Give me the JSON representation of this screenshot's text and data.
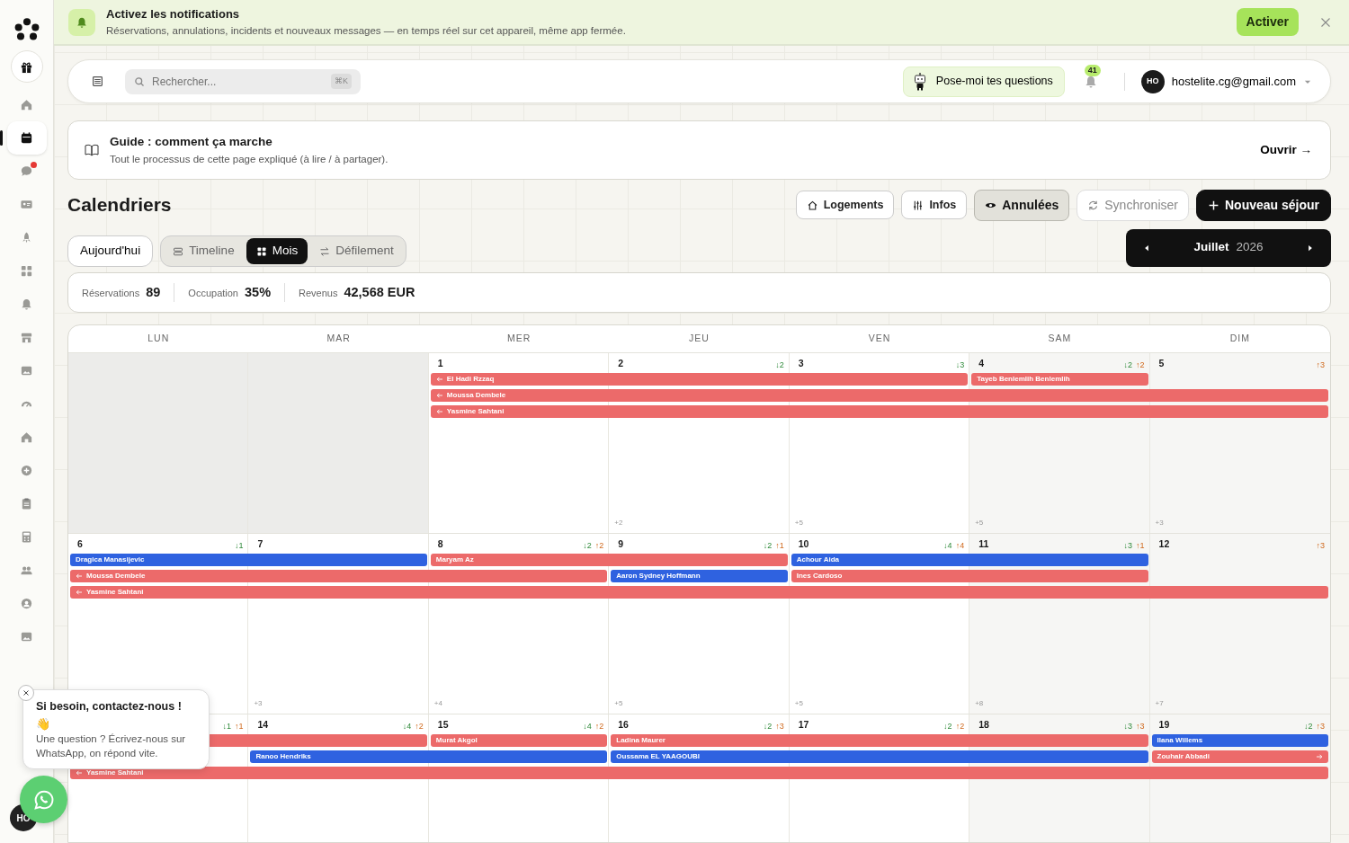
{
  "banner": {
    "title": "Activez les notifications",
    "text": "Réservations, annulations, incidents et nouveaux messages — en temps réel sur cet appareil, même app fermée.",
    "action": "Activer"
  },
  "sidebar": {
    "items": [
      {
        "selected": false,
        "badge": false
      },
      {
        "selected": false,
        "badge": false
      },
      {
        "selected": true,
        "badge": false
      },
      {
        "selected": false,
        "badge": true
      },
      {
        "selected": false,
        "badge": false
      },
      {
        "selected": false,
        "badge": false
      },
      {
        "selected": false,
        "badge": false
      },
      {
        "selected": false,
        "badge": false
      },
      {
        "selected": false,
        "badge": false
      },
      {
        "selected": false,
        "badge": false
      },
      {
        "selected": false,
        "badge": false
      },
      {
        "selected": false,
        "badge": false
      },
      {
        "selected": false,
        "badge": false
      },
      {
        "selected": false,
        "badge": false
      },
      {
        "selected": false,
        "badge": false
      },
      {
        "selected": false,
        "badge": false
      },
      {
        "selected": false,
        "badge": false
      },
      {
        "selected": false,
        "badge": false
      }
    ],
    "avatar": "HO"
  },
  "header": {
    "search": {
      "placeholder": "Rechercher...",
      "shortcut": "⌘K"
    },
    "assistant": "Pose-moi tes questions",
    "notifications": "41",
    "user": {
      "initials": "HO",
      "email": "hostelite.cg@gmail.com"
    }
  },
  "guide": {
    "title": "Guide : comment ça marche",
    "text": "Tout le processus de cette page expliqué (à lire / à partager).",
    "action": "Ouvrir →"
  },
  "title": "Calendriers",
  "actions": [
    {
      "label": "Logements",
      "kind": "outline",
      "on": false
    },
    {
      "label": "Infos",
      "kind": "outline",
      "on": false
    },
    {
      "label": "Annulées",
      "kind": "toggle",
      "on": true
    },
    {
      "label": "Synchroniser",
      "kind": "muted",
      "on": false
    },
    {
      "label": "Nouveau séjour",
      "kind": "primary",
      "on": false
    }
  ],
  "today": "Aujourd'hui",
  "views": [
    {
      "label": "Timeline",
      "selected": false
    },
    {
      "label": "Mois",
      "selected": true
    },
    {
      "label": "Défilement",
      "selected": false
    }
  ],
  "month": {
    "name": "Juillet",
    "year": "2026"
  },
  "stats": [
    {
      "label": "Réservations",
      "value": "89"
    },
    {
      "label": "Occupation",
      "value": "35%"
    },
    {
      "label": "Revenus",
      "value": "42,568 EUR"
    }
  ],
  "calendar": {
    "weekdays": [
      "LUN",
      "MAR",
      "MER",
      "JEU",
      "VEN",
      "SAM",
      "DIM"
    ],
    "weeks": [
      {
        "days": [
          {
            "in_month": false
          },
          {
            "in_month": false
          },
          {
            "day": "1"
          },
          {
            "day": "2",
            "in": "↓2",
            "more": "+2"
          },
          {
            "day": "3",
            "in": "↓3",
            "more": "+5"
          },
          {
            "day": "4",
            "in": "↓2",
            "out": "↑2",
            "more": "+5"
          },
          {
            "day": "5",
            "out": "↑3",
            "more": "+3"
          }
        ],
        "lanes": [
          [
            {
              "kind": "none"
            },
            {
              "kind": "none"
            },
            {
              "kind": "start",
              "guest": "El Hadi Rzzaq",
              "color": "#ec6a6a",
              "from_before": true
            },
            {
              "kind": "more"
            },
            {
              "kind": "more"
            },
            {
              "kind": "start",
              "guest": "Tayeb Benlemlih Benlemlih",
              "color": "#ec6a6a"
            },
            {
              "kind": "none"
            }
          ],
          [
            {
              "kind": "none"
            },
            {
              "kind": "none"
            },
            {
              "kind": "start",
              "guest": "Moussa Dembele",
              "color": "#ec6a6a",
              "from_before": true
            },
            {
              "kind": "more"
            },
            {
              "kind": "more"
            },
            {
              "kind": "more"
            },
            {
              "kind": "more"
            }
          ],
          [
            {
              "kind": "none"
            },
            {
              "kind": "none"
            },
            {
              "kind": "start",
              "guest": "Yasmine Sahtani",
              "color": "#ec6a6a",
              "from_before": true
            },
            {
              "kind": "more"
            },
            {
              "kind": "more"
            },
            {
              "kind": "more"
            },
            {
              "kind": "more"
            }
          ]
        ]
      },
      {
        "days": [
          {
            "day": "6",
            "in": "↓1"
          },
          {
            "day": "7",
            "more": "+3"
          },
          {
            "day": "8",
            "in": "↓2",
            "out": "↑2",
            "more": "+4"
          },
          {
            "day": "9",
            "in": "↓2",
            "out": "↑1",
            "more": "+5"
          },
          {
            "day": "10",
            "in": "↓4",
            "out": "↑4",
            "more": "+5"
          },
          {
            "day": "11",
            "in": "↓3",
            "out": "↑1",
            "more": "+8"
          },
          {
            "day": "12",
            "out": "↑3",
            "more": "+7"
          }
        ],
        "lanes": [
          [
            {
              "kind": "start",
              "guest": "Dragica Manasijevic",
              "color": "#2f62e0"
            },
            {
              "kind": "more"
            },
            {
              "kind": "start",
              "guest": "Maryam Az",
              "color": "#ec6a6a"
            },
            {
              "kind": "more"
            },
            {
              "kind": "start",
              "guest": "Achour Aida",
              "color": "#2f62e0"
            },
            {
              "kind": "more"
            },
            {
              "kind": "none"
            }
          ],
          [
            {
              "kind": "start",
              "guest": "Moussa Dembele",
              "color": "#ec6a6a",
              "from_before": true
            },
            {
              "kind": "more"
            },
            {
              "kind": "more"
            },
            {
              "kind": "start",
              "guest": "Aaron Sydney Hoffmann",
              "color": "#2f62e0"
            },
            {
              "kind": "start",
              "guest": "Ines Cardoso",
              "color": "#ec6a6a"
            },
            {
              "kind": "more"
            },
            {
              "kind": "none"
            }
          ],
          [
            {
              "kind": "start",
              "guest": "Yasmine Sahtani",
              "color": "#ec6a6a",
              "from_before": true
            },
            {
              "kind": "more"
            },
            {
              "kind": "more"
            },
            {
              "kind": "more"
            },
            {
              "kind": "more"
            },
            {
              "kind": "more"
            },
            {
              "kind": "more"
            }
          ]
        ]
      },
      {
        "days": [
          {
            "in": "↓1",
            "out": "↑1"
          },
          {
            "day": "14",
            "in": "↓4",
            "out": "↑2"
          },
          {
            "day": "15",
            "in": "↓4",
            "out": "↑2"
          },
          {
            "day": "16",
            "in": "↓2",
            "out": "↑3"
          },
          {
            "day": "17",
            "in": "↓2",
            "out": "↑2"
          },
          {
            "day": "18",
            "in": "↓3",
            "out": "↑3"
          },
          {
            "day": "19",
            "in": "↓2",
            "out": "↑3"
          }
        ],
        "lanes": [
          [
            {
              "kind": "start",
              "color": "#ec6a6a"
            },
            {
              "kind": "more"
            },
            {
              "kind": "start",
              "guest": "Murat Akgol",
              "color": "#ec6a6a"
            },
            {
              "kind": "start",
              "guest": "Ladina Maurer",
              "color": "#ec6a6a"
            },
            {
              "kind": "more"
            },
            {
              "kind": "more"
            },
            {
              "kind": "start",
              "guest": "Ilana Willems",
              "color": "#2f62e0"
            }
          ],
          [
            {
              "kind": "none"
            },
            {
              "kind": "start",
              "guest": "Ranoo Hendriks",
              "color": "#2f62e0"
            },
            {
              "kind": "more"
            },
            {
              "kind": "start",
              "guest": "Oussama EL YAAGOUBI",
              "color": "#2f62e0"
            },
            {
              "kind": "more"
            },
            {
              "kind": "more"
            },
            {
              "kind": "start",
              "guest": "Zouhair Abbadi",
              "color": "#ec6a6a",
              "to_after": true
            }
          ],
          [
            {
              "kind": "start",
              "guest": "Yasmine Sahtani",
              "color": "#ec6a6a",
              "from_before": true
            },
            {
              "kind": "more"
            },
            {
              "kind": "more"
            },
            {
              "kind": "more"
            },
            {
              "kind": "more"
            },
            {
              "kind": "more"
            },
            {
              "kind": "more"
            }
          ]
        ]
      }
    ]
  },
  "help": {
    "title": "Si besoin, contactez-nous !",
    "emoji": "👋",
    "text": "Une question ? Écrivez-nous sur WhatsApp, on répond vite."
  }
}
